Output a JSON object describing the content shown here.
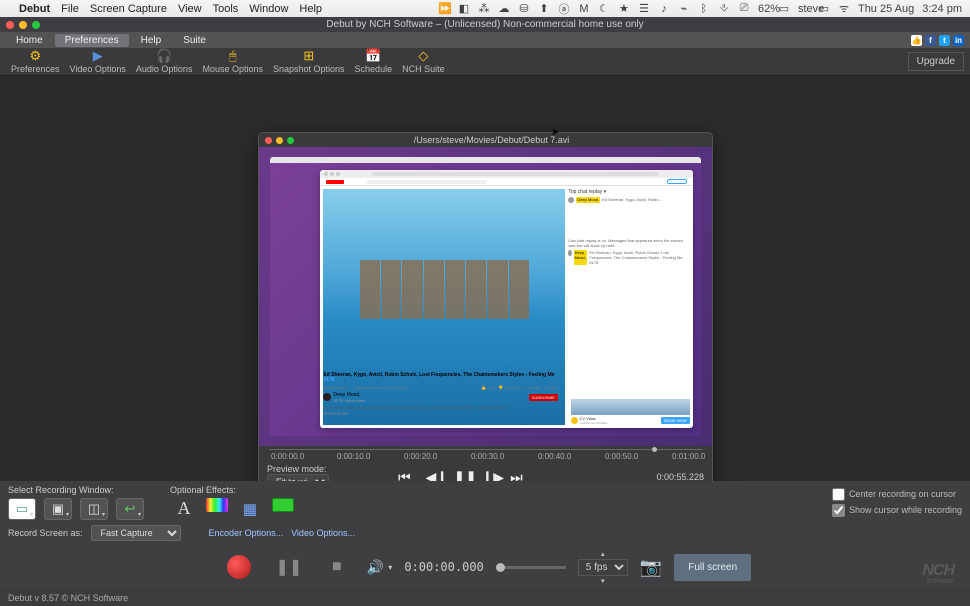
{
  "menubar": {
    "apple": "",
    "appname": "Debut",
    "items": [
      "File",
      "Screen Capture",
      "View",
      "Tools",
      "Window",
      "Help"
    ],
    "right_icons": [
      "⏩",
      "◧",
      "⁂",
      "☁",
      "⛁",
      "⬆",
      "ⓐ",
      "M",
      "☾",
      "★",
      "☰",
      "♪",
      "⌁",
      "ᛒ",
      "⎀",
      "⎚",
      "⚇"
    ],
    "battery": "62%",
    "battery_icon": "▭",
    "user": "steve",
    "fullscreen": "▭",
    "wifi": "ᯤ",
    "date": "Thu 25 Aug",
    "time": "3:24 pm"
  },
  "window": {
    "title": "Debut by NCH Software – (Unlicensed) Non-commercial home use only"
  },
  "tabs": {
    "items": [
      "Home",
      "Preferences",
      "Help",
      "Suite"
    ],
    "active": 1,
    "socials": [
      "👍",
      "f",
      "t",
      "in"
    ]
  },
  "toolbar": {
    "items": [
      {
        "icon": "⚙",
        "label": "Preferences"
      },
      {
        "icon": "▶",
        "label": "Video Options"
      },
      {
        "icon": "🎧",
        "label": "Audio Options"
      },
      {
        "icon": "🖰",
        "label": "Mouse Options"
      },
      {
        "icon": "⊞",
        "label": "Snapshot Options"
      },
      {
        "icon": "📅",
        "label": "Schedule"
      },
      {
        "icon": "◇",
        "label": "NCH Suite"
      }
    ],
    "upgrade": "Upgrade"
  },
  "preview": {
    "title": "/Users/steve/Movies/Debut/Debut 7.avi",
    "sim": {
      "yt_label": "YouTube",
      "url": "youtube.com",
      "signin": "SIGN IN",
      "search": "Search",
      "video_title": "Ed Sheeran, Kygo, Avicii, Robin Schulz, Lost Frequencies, The Chainsmokers Styles - Feeling Me ",
      "video_num": "#175",
      "views": "24,960 views",
      "stream_date": "Streamed live on 24 Aug 2022",
      "likes": "2.1K",
      "dislike": "DISLIKE",
      "share": "SHARE",
      "save": "SAVE",
      "channel": "Deep Mood.",
      "subs": "45.7K subscribers",
      "subscribe": "SUBSCRIBE",
      "desc": "Ed Sheeran, Kygo, Avicii, Robin Schulz, Lost Frequencies, The Chainsmokers Styles - Feeling Me #175",
      "showmore": "SHOW MORE",
      "chat_header": "Top chat replay ▾",
      "chat_items": [
        {
          "name": "Deep Mood.",
          "text": "Ed Sheeran, Kygo, Avicii, Robin...",
          "pinned": true
        },
        {
          "name": "",
          "text": "Live chat replay is on. Messages that appeared when the stream was live will show up here.",
          "pinned": false
        },
        {
          "name": "Deep Mood.",
          "text": "Ed Sheeran, Kygo, Avicii, Robin Schulz, Lost Frequencies, The Chainsmokers Styles - Feeling Me #175",
          "pinned": true
        }
      ],
      "ad": {
        "brand": "CV Villas",
        "sub": "youtube.com/cvvillas",
        "cta": "BOOK NOW"
      }
    },
    "timeline": {
      "ticks": [
        "0:00:00.0",
        "0:00:10.0",
        "0:00:20.0",
        "0:00:30.0",
        "0:00:40.0",
        "0:00:50.0",
        "0:01:00.0"
      ]
    },
    "controls": {
      "mode_label": "Preview mode:",
      "mode_value": "Fit to window",
      "time": "0:00:55.228"
    }
  },
  "bottom": {
    "select_label": "Select Recording Window:",
    "effects_label": "Optional Effects:",
    "check1": "Center recording on cursor",
    "check2": "Show cursor while recording",
    "record_as": "Record Screen as:",
    "method": "Fast Capture",
    "encoder": "Encoder Options...",
    "video_opts": "Video Options...",
    "time": "0:00:00.000",
    "fps": "5 fps",
    "fullscreen": "Full screen"
  },
  "footer": {
    "version": "Debut v 8.57  © NCH Software",
    "brand": "NCH",
    "brand2": "Software"
  }
}
